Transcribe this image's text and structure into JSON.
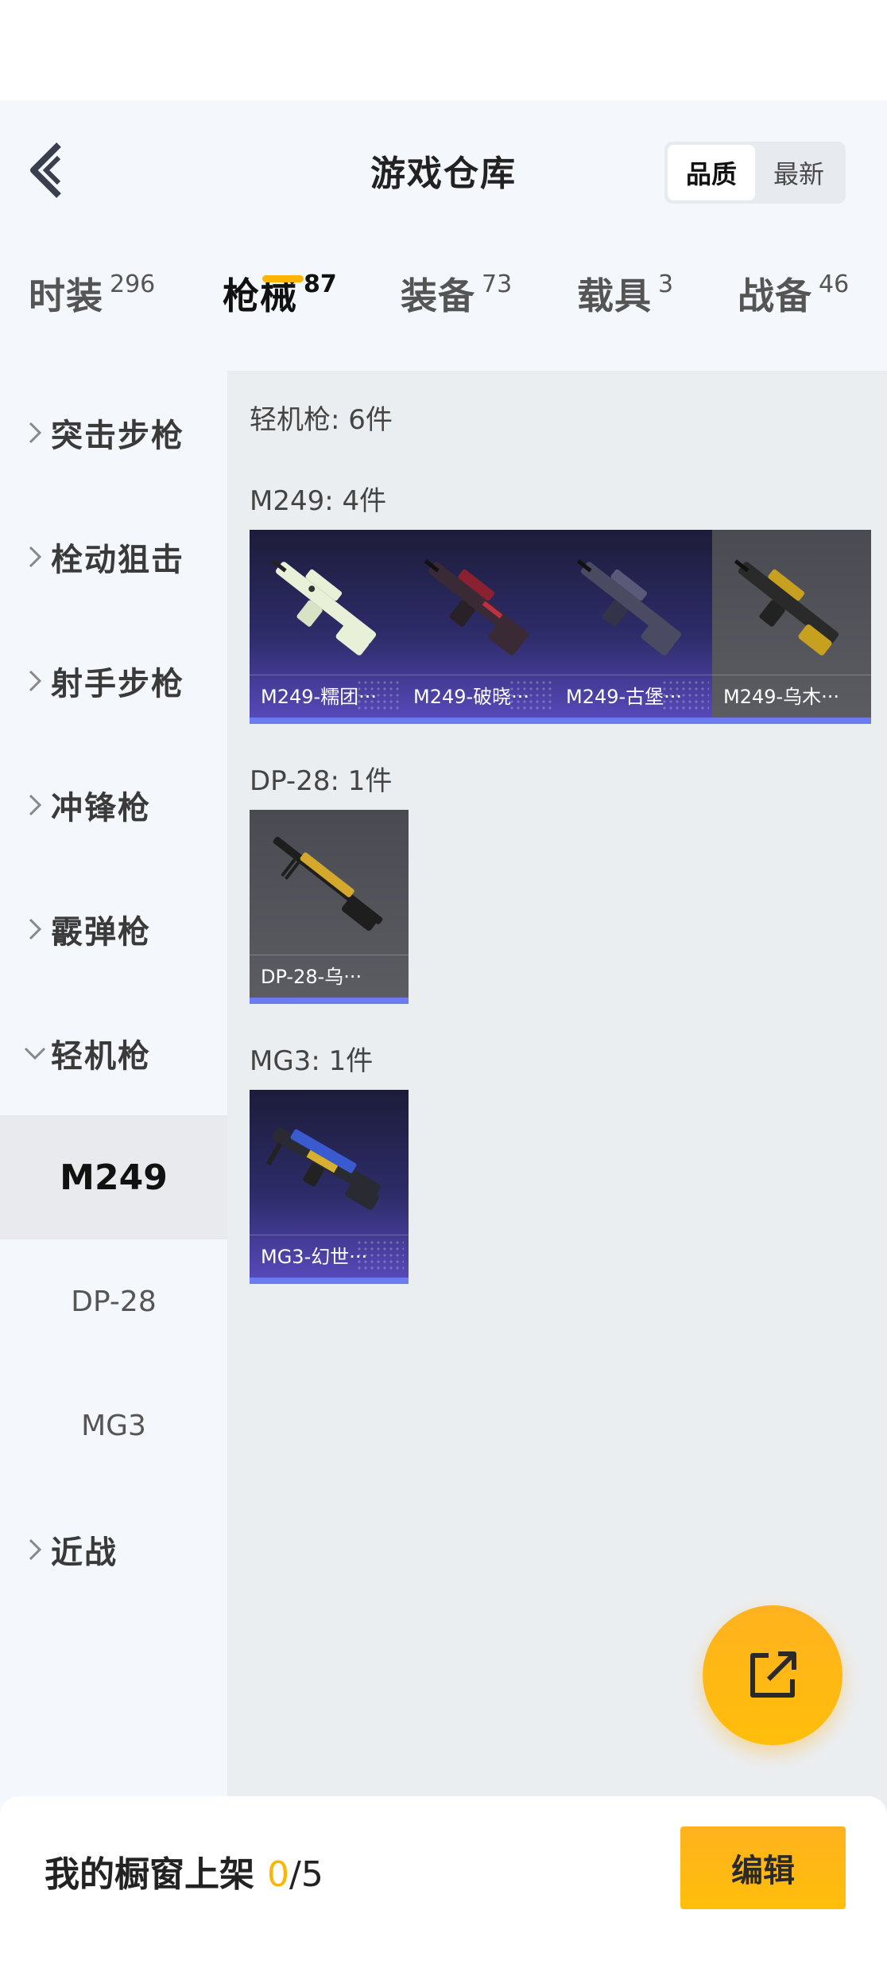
{
  "header": {
    "title": "游戏仓库",
    "sort_options": [
      "品质",
      "最新"
    ],
    "active_sort": "品质"
  },
  "tabs": [
    {
      "label": "时装",
      "count": "296"
    },
    {
      "label": "枪械",
      "count": "87"
    },
    {
      "label": "装备",
      "count": "73"
    },
    {
      "label": "载具",
      "count": "3"
    },
    {
      "label": "战备",
      "count": "46"
    }
  ],
  "active_tab": "枪械",
  "sidebar": {
    "categories": [
      "突击步枪",
      "栓动狙击",
      "射手步枪",
      "冲锋枪",
      "霰弹枪",
      "轻机枪",
      "近战"
    ],
    "expanded": "轻机枪",
    "subitems": [
      "M249",
      "DP-28",
      "MG3"
    ],
    "active_subitem": "M249"
  },
  "content": {
    "section_title": "轻机枪: 6件",
    "groups": [
      {
        "title": "M249: 4件",
        "items": [
          {
            "name": "M249-糯团···",
            "rarity": "purple",
            "gun_color": "#e8f0d8"
          },
          {
            "name": "M249-破晓···",
            "rarity": "purple",
            "gun_color": "#8a2030"
          },
          {
            "name": "M249-古堡···",
            "rarity": "purple",
            "gun_color": "#5a5a78"
          },
          {
            "name": "M249-乌木···",
            "rarity": "grey",
            "gun_color": "#c8a020"
          }
        ]
      },
      {
        "title": "DP-28: 1件",
        "items": [
          {
            "name": "DP-28-乌···",
            "rarity": "grey",
            "gun_color": "#d4a82a"
          }
        ]
      },
      {
        "title": "MG3: 1件",
        "items": [
          {
            "name": "MG3-幻世···",
            "rarity": "purple",
            "gun_color": "#3a5ad0"
          }
        ]
      }
    ]
  },
  "bottom": {
    "showcase_label": "我的橱窗上架",
    "showcase_count": "0",
    "showcase_total": "/5",
    "edit_label": "编辑"
  },
  "colors": {
    "accent": "#ffb400",
    "rarity_purple": "#5a4bc0",
    "rarity_bar": "#6a7cf0",
    "rarity_grey": "#5c5d63"
  }
}
